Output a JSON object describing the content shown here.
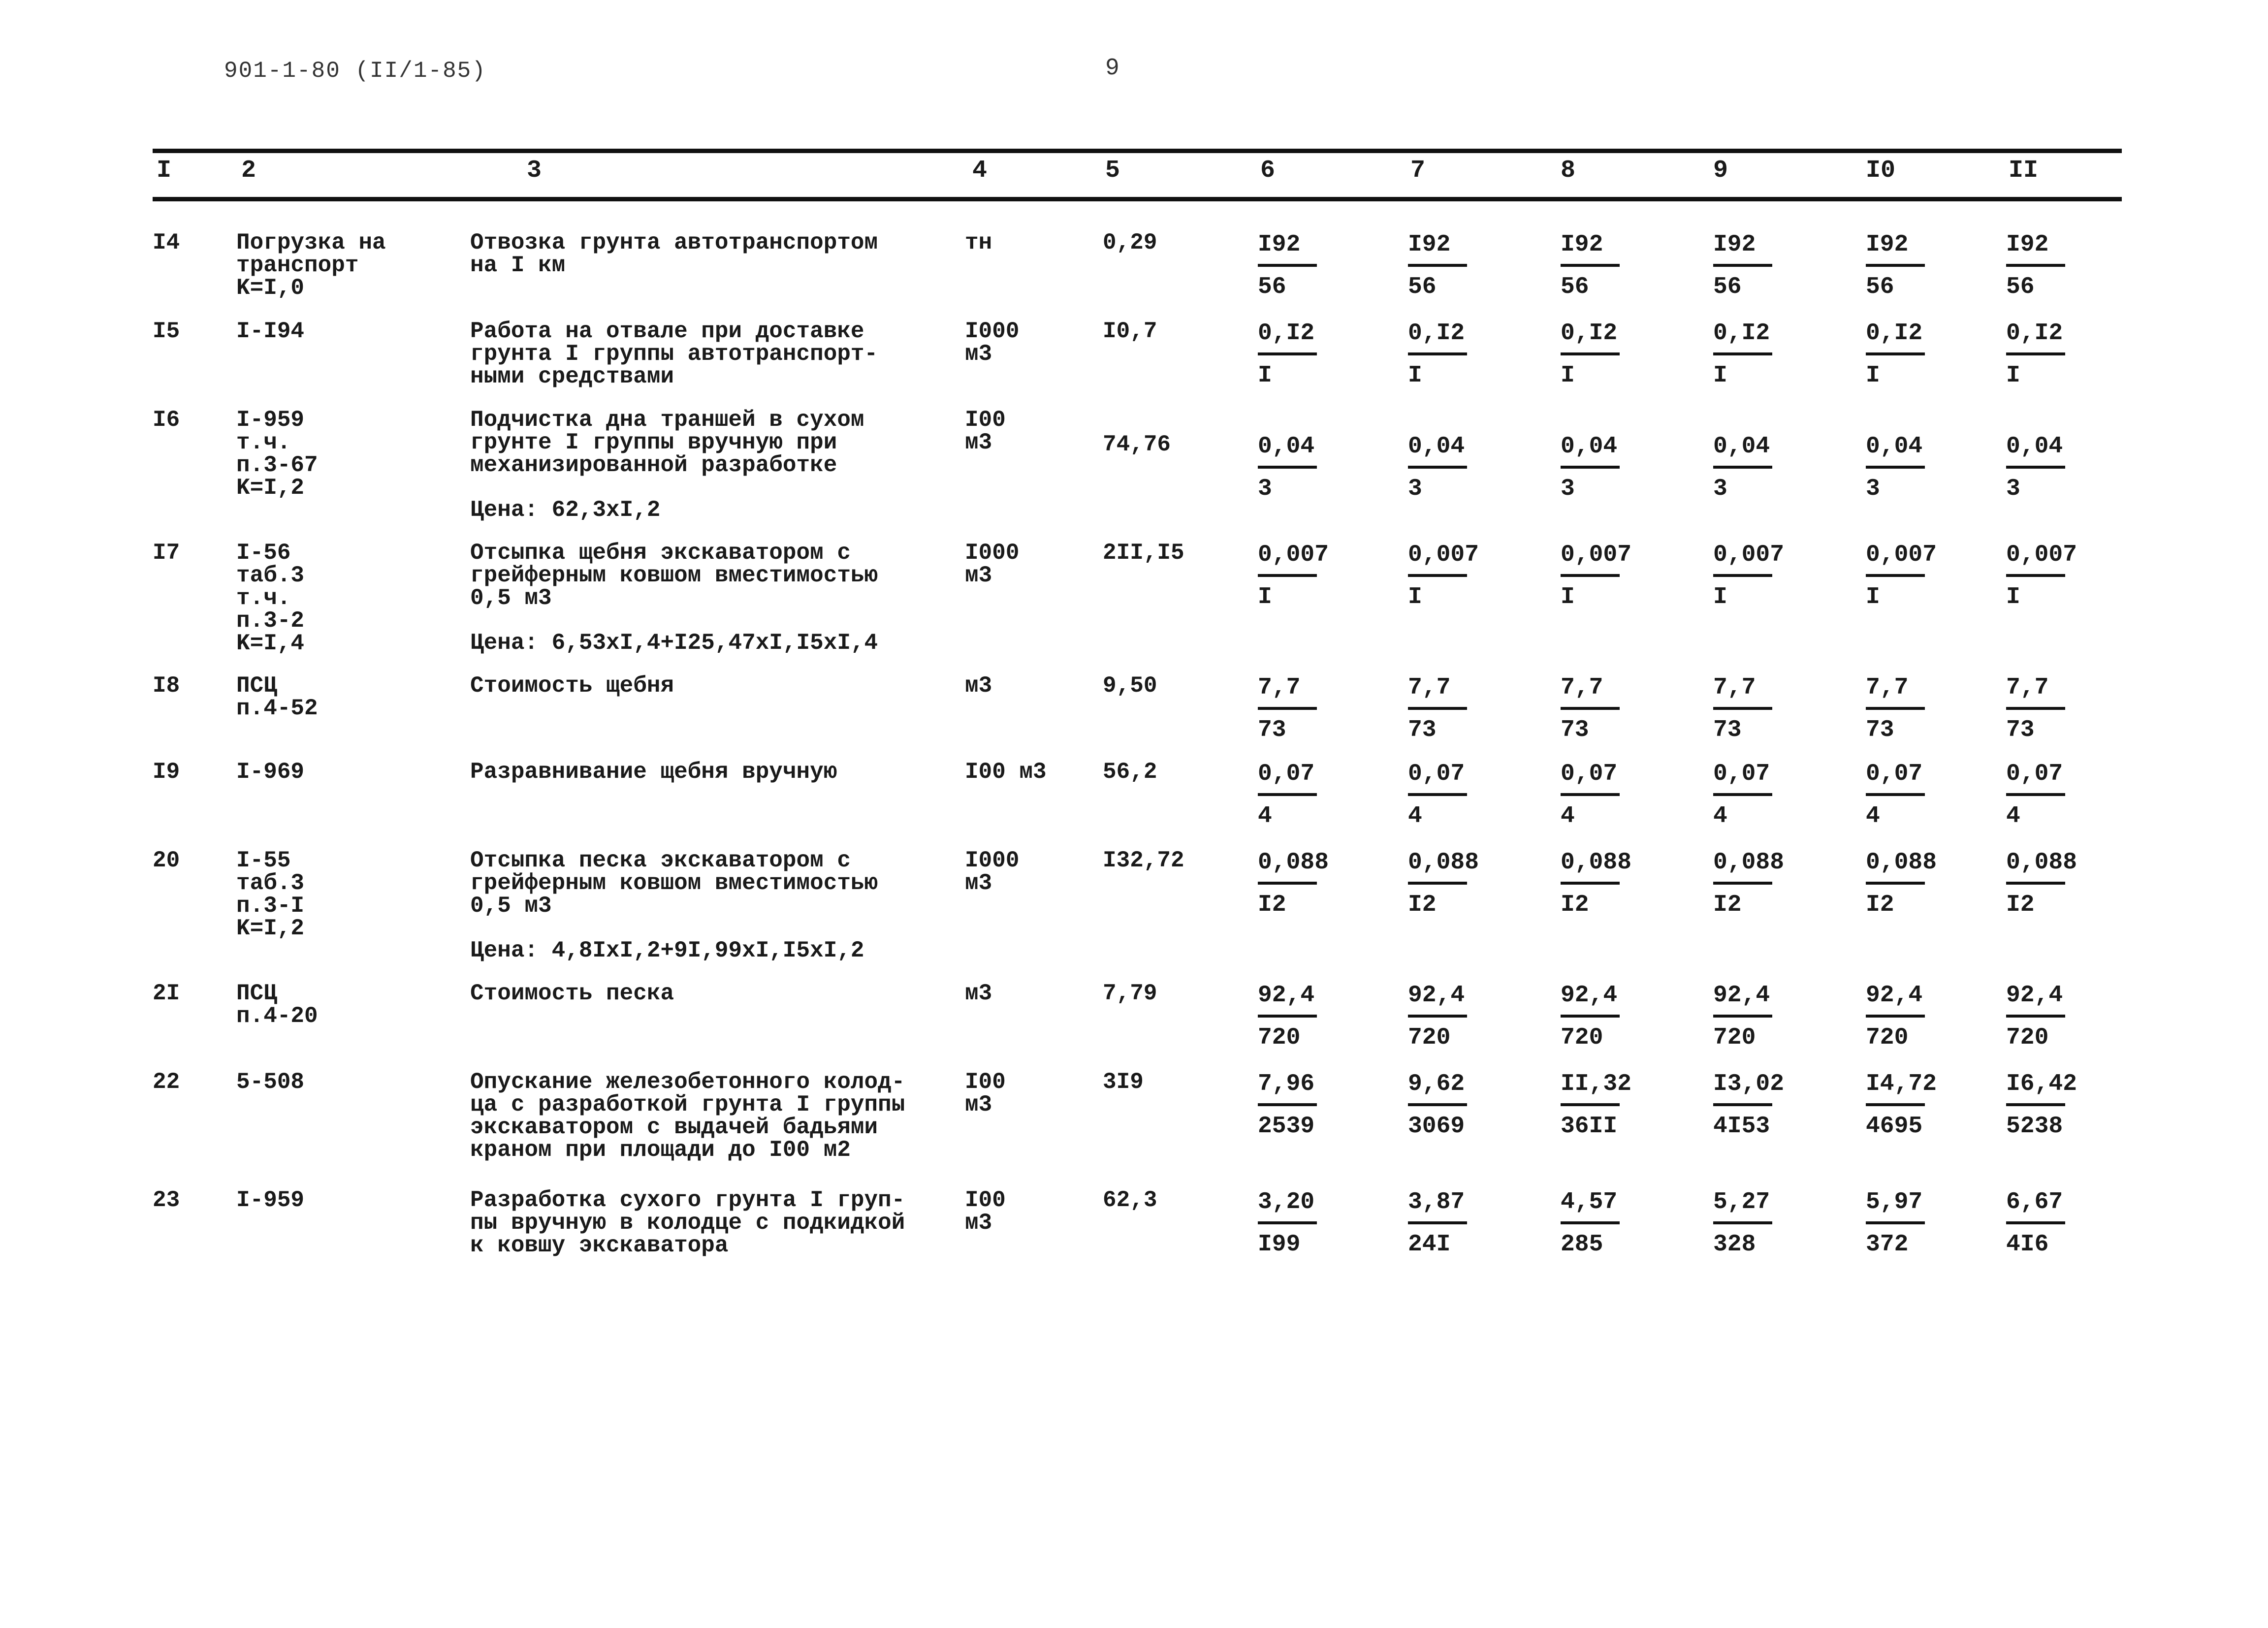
{
  "page_header": {
    "doc_code": "901-1-80 (II/1-85)",
    "page_number": "9"
  },
  "columns": [
    "I",
    "2",
    "3",
    "4",
    "5",
    "6",
    "7",
    "8",
    "9",
    "I0",
    "II"
  ],
  "rows": [
    {
      "no": "I4",
      "ref": "Погрузка на\nтранспорт\nK=I,0",
      "desc": "Отвозка грунта автотранспортом\nна I км",
      "price_formula": "",
      "unit": "тн",
      "unit_price": "0,29",
      "values": [
        [
          "I92",
          "56"
        ],
        [
          "I92",
          "56"
        ],
        [
          "I92",
          "56"
        ],
        [
          "I92",
          "56"
        ],
        [
          "I92",
          "56"
        ],
        [
          "I92",
          "56"
        ]
      ]
    },
    {
      "no": "I5",
      "ref": "I-I94",
      "desc": "Работа на отвале при доставке\nгрунта I группы автотранспорт-\nными средствами",
      "price_formula": "",
      "unit": "I000\nм3",
      "unit_price": "I0,7",
      "values": [
        [
          "0,I2",
          "I"
        ],
        [
          "0,I2",
          "I"
        ],
        [
          "0,I2",
          "I"
        ],
        [
          "0,I2",
          "I"
        ],
        [
          "0,I2",
          "I"
        ],
        [
          "0,I2",
          "I"
        ]
      ]
    },
    {
      "no": "I6",
      "ref": "I-959\nт.ч.\nп.3-67\nK=I,2",
      "desc": "Подчистка дна траншей в сухом\nгрунте I группы вручную при\nмеханизированной разработке",
      "price_formula": "Цена: 62,3xI,2",
      "unit": "I00\nм3",
      "unit_price": "74,76",
      "values": [
        [
          "0,04",
          "3"
        ],
        [
          "0,04",
          "3"
        ],
        [
          "0,04",
          "3"
        ],
        [
          "0,04",
          "3"
        ],
        [
          "0,04",
          "3"
        ],
        [
          "0,04",
          "3"
        ]
      ]
    },
    {
      "no": "I7",
      "ref": "I-56\nтаб.3\nт.ч.\nп.3-2\nK=I,4",
      "desc": "Отсыпка щебня экскаватором с\nгрейферным ковшом вместимостью\n0,5 м3",
      "price_formula": "Цена: 6,53xI,4+I25,47xI,I5xI,4",
      "unit": "I000\nм3",
      "unit_price": "2II,I5",
      "values": [
        [
          "0,007",
          "I"
        ],
        [
          "0,007",
          "I"
        ],
        [
          "0,007",
          "I"
        ],
        [
          "0,007",
          "I"
        ],
        [
          "0,007",
          "I"
        ],
        [
          "0,007",
          "I"
        ]
      ]
    },
    {
      "no": "I8",
      "ref": "ПСЦ\nп.4-52",
      "desc": "Стоимость щебня",
      "price_formula": "",
      "unit": "м3",
      "unit_price": "9,50",
      "values": [
        [
          "7,7",
          "73"
        ],
        [
          "7,7",
          "73"
        ],
        [
          "7,7",
          "73"
        ],
        [
          "7,7",
          "73"
        ],
        [
          "7,7",
          "73"
        ],
        [
          "7,7",
          "73"
        ]
      ]
    },
    {
      "no": "I9",
      "ref": "I-969",
      "desc": "Разравнивание щебня вручную",
      "price_formula": "",
      "unit": "I00 м3",
      "unit_price": "56,2",
      "values": [
        [
          "0,07",
          "4"
        ],
        [
          "0,07",
          "4"
        ],
        [
          "0,07",
          "4"
        ],
        [
          "0,07",
          "4"
        ],
        [
          "0,07",
          "4"
        ],
        [
          "0,07",
          "4"
        ]
      ]
    },
    {
      "no": "20",
      "ref": "I-55\nтаб.3\nп.3-I\nK=I,2",
      "desc": "Отсыпка песка экскаватором с\nгрейферным ковшом вместимостью\n0,5 м3",
      "price_formula": "Цена: 4,8IxI,2+9I,99xI,I5xI,2",
      "unit": "I000\nм3",
      "unit_price": "I32,72",
      "values": [
        [
          "0,088",
          "I2"
        ],
        [
          "0,088",
          "I2"
        ],
        [
          "0,088",
          "I2"
        ],
        [
          "0,088",
          "I2"
        ],
        [
          "0,088",
          "I2"
        ],
        [
          "0,088",
          "I2"
        ]
      ]
    },
    {
      "no": "2I",
      "ref": "ПСЦ\nп.4-20",
      "desc": "Стоимость песка",
      "price_formula": "",
      "unit": "м3",
      "unit_price": "7,79",
      "values": [
        [
          "92,4",
          "720"
        ],
        [
          "92,4",
          "720"
        ],
        [
          "92,4",
          "720"
        ],
        [
          "92,4",
          "720"
        ],
        [
          "92,4",
          "720"
        ],
        [
          "92,4",
          "720"
        ]
      ]
    },
    {
      "no": "22",
      "ref": "5-508",
      "desc": "Опускание железобетонного колод-\nца с разработкой грунта I группы\nэкскаватором с выдачей бадьями\nкраном при площади до I00 м2",
      "price_formula": "",
      "unit": "I00\nм3",
      "unit_price": "3I9",
      "values": [
        [
          "7,96",
          "2539"
        ],
        [
          "9,62",
          "3069"
        ],
        [
          "II,32",
          "36II"
        ],
        [
          "I3,02",
          "4I53"
        ],
        [
          "I4,72",
          "4695"
        ],
        [
          "I6,42",
          "5238"
        ]
      ]
    },
    {
      "no": "23",
      "ref": "I-959",
      "desc": "Разработка сухого грунта I груп-\nпы вручную в колодце с подкидкой\nк ковшу экскаватора",
      "price_formula": "",
      "unit": "I00\nм3",
      "unit_price": "62,3",
      "values": [
        [
          "3,20",
          "I99"
        ],
        [
          "3,87",
          "24I"
        ],
        [
          "4,57",
          "285"
        ],
        [
          "5,27",
          "328"
        ],
        [
          "5,97",
          "372"
        ],
        [
          "6,67",
          "4I6"
        ]
      ]
    }
  ]
}
